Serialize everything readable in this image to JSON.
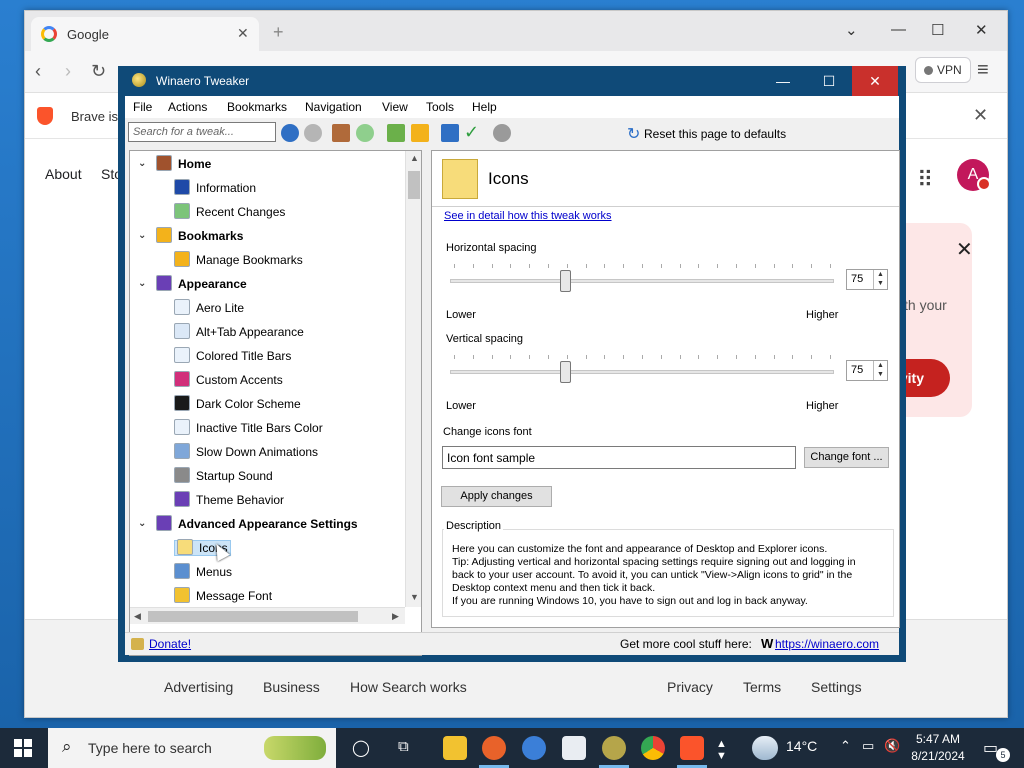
{
  "browser": {
    "tab_title": "Google",
    "tab_close": "✕",
    "new_tab": "+",
    "vpn_label": "VPN",
    "infobar_text": "Brave is",
    "infobar_close": "✕",
    "header_links": [
      "About",
      "Sto"
    ],
    "avatar_letter": "A",
    "promo_text": "th your",
    "promo_button": "vity",
    "footer_links": [
      "Advertising",
      "Business",
      "How Search works",
      "Privacy",
      "Terms",
      "Settings"
    ]
  },
  "app": {
    "title": "Winaero Tweaker",
    "menu": [
      "File",
      "Actions",
      "Bookmarks",
      "Navigation",
      "View",
      "Tools",
      "Help"
    ],
    "search_placeholder": "Search for a tweak...",
    "reset_label": "Reset this page to defaults",
    "tree": [
      {
        "label": "Home",
        "type": "category",
        "icon_color": "#a0522d"
      },
      {
        "label": "Information",
        "type": "item",
        "icon_color": "#1f4aa8"
      },
      {
        "label": "Recent Changes",
        "type": "item",
        "icon_color": "#7cc47a"
      },
      {
        "label": "Bookmarks",
        "type": "category",
        "icon_color": "#f3b21b"
      },
      {
        "label": "Manage Bookmarks",
        "type": "item",
        "icon_color": "#f3b21b"
      },
      {
        "label": "Appearance",
        "type": "category",
        "icon_color": "#6a3fb5"
      },
      {
        "label": "Aero Lite",
        "type": "item",
        "icon_color": "#eaf2fb"
      },
      {
        "label": "Alt+Tab Appearance",
        "type": "item",
        "icon_color": "#dbe8f7"
      },
      {
        "label": "Colored Title Bars",
        "type": "item",
        "icon_color": "#eaf2fb"
      },
      {
        "label": "Custom Accents",
        "type": "item",
        "icon_color": "#d12f7a"
      },
      {
        "label": "Dark Color Scheme",
        "type": "item",
        "icon_color": "#1a1a1a"
      },
      {
        "label": "Inactive Title Bars Color",
        "type": "item",
        "icon_color": "#eaf2fb"
      },
      {
        "label": "Slow Down Animations",
        "type": "item",
        "icon_color": "#7fa7d9"
      },
      {
        "label": "Startup Sound",
        "type": "item",
        "icon_color": "#8a8a8a"
      },
      {
        "label": "Theme Behavior",
        "type": "item",
        "icon_color": "#6a3fb5"
      },
      {
        "label": "Advanced Appearance Settings",
        "type": "category",
        "icon_color": "#6a3fb5"
      },
      {
        "label": "Icons",
        "type": "item",
        "icon_color": "#f7dc7a",
        "selected": true
      },
      {
        "label": "Menus",
        "type": "item",
        "icon_color": "#5b8fd0"
      },
      {
        "label": "Message Font",
        "type": "item",
        "icon_color": "#f2c230"
      }
    ],
    "panel": {
      "title": "Icons",
      "detail_link": "See in detail how this tweak works",
      "horizontal": {
        "label": "Horizontal spacing",
        "value": "75",
        "level": 0.3,
        "lower": "Lower",
        "higher": "Higher"
      },
      "vertical": {
        "label": "Vertical spacing",
        "value": "75",
        "level": 0.3,
        "lower": "Lower",
        "higher": "Higher"
      },
      "font_label": "Change icons font",
      "font_sample": "Icon font sample",
      "change_font": "Change font ...",
      "apply": "Apply changes",
      "description_title": "Description",
      "description_lines": [
        "Here you can customize the font and appearance of Desktop and Explorer icons.",
        "Tip: Adjusting vertical and horizontal spacing settings require signing out and logging in",
        "back to your user account. To avoid it, you can untick \"View->Align icons to grid\" in the",
        "Desktop context menu and then tick it back.",
        "If you are running Windows 10, you have to sign out and log in back anyway."
      ]
    },
    "status": {
      "donate": "Donate!",
      "more_text": "Get more cool stuff here:",
      "w_logo": "W",
      "more_link": "https://winaero.com"
    }
  },
  "taskbar": {
    "search_placeholder": "Type here to search",
    "weather": "14°C",
    "time": "5:47 AM",
    "date": "8/21/2024",
    "notification_count": "5"
  }
}
